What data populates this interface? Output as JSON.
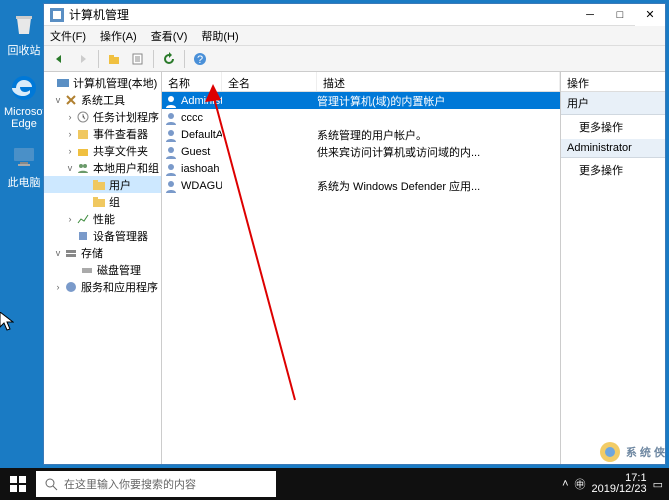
{
  "desktop": {
    "recycle": "回收站",
    "edge": "Microsoft Edge",
    "pc": "此电脑"
  },
  "window": {
    "title": "计算机管理",
    "menu": {
      "file": "文件(F)",
      "action": "操作(A)",
      "view": "查看(V)",
      "help": "帮助(H)"
    }
  },
  "tree": {
    "root": "计算机管理(本地)",
    "systools": "系统工具",
    "tasksched": "任务计划程序",
    "eventviewer": "事件查看器",
    "sharedfolders": "共享文件夹",
    "localusers": "本地用户和组",
    "users": "用户",
    "groups": "组",
    "perf": "性能",
    "devmgr": "设备管理器",
    "storage": "存储",
    "diskmgr": "磁盘管理",
    "services": "服务和应用程序"
  },
  "list": {
    "hdr": {
      "name": "名称",
      "full": "全名",
      "desc": "描述"
    },
    "rows": [
      {
        "name": "Administrat...",
        "full": "",
        "desc": "管理计算机(域)的内置帐户"
      },
      {
        "name": "cccc",
        "full": "",
        "desc": ""
      },
      {
        "name": "DefaultAcc...",
        "full": "",
        "desc": "系统管理的用户帐户。"
      },
      {
        "name": "Guest",
        "full": "",
        "desc": "供来宾访问计算机或访问域的内..."
      },
      {
        "name": "iashoah",
        "full": "",
        "desc": ""
      },
      {
        "name": "WDAGUtilit...",
        "full": "",
        "desc": "系统为 Windows Defender 应用..."
      }
    ]
  },
  "actions": {
    "hdr": "操作",
    "sec1": "用户",
    "more1": "更多操作",
    "sec2": "Administrator",
    "more2": "更多操作"
  },
  "taskbar": {
    "search_placeholder": "在这里输入你要搜索的内容"
  },
  "tray": {
    "time": "17:1",
    "date": "2019/12/23"
  },
  "watermark": "系 统 侠"
}
